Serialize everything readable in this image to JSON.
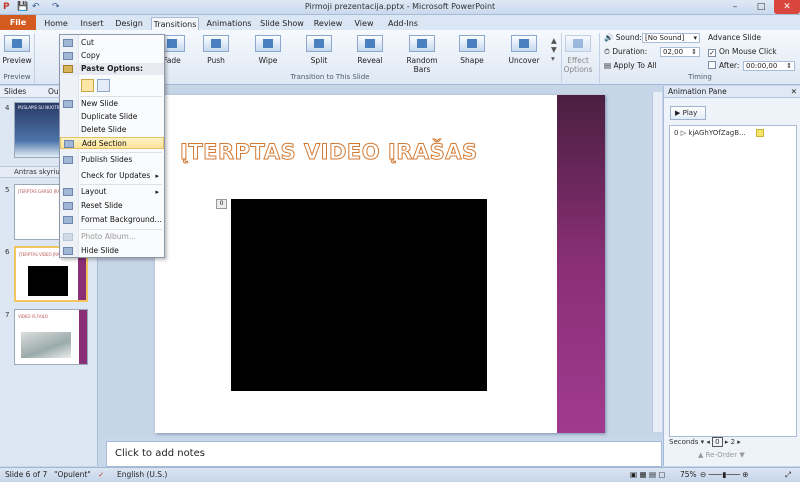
{
  "window": {
    "title": "Pirmoji prezentacija.pptx - Microsoft PowerPoint",
    "controls": [
      "–",
      "□",
      "✕"
    ]
  },
  "quick_access": {
    "app_icon": "P",
    "save": "💾",
    "undo": "↶",
    "redo": "↷"
  },
  "tabs": [
    "File",
    "Home",
    "Insert",
    "Design",
    "Transitions",
    "Animations",
    "Slide Show",
    "Review",
    "View",
    "Add-Ins"
  ],
  "active_tab": "Transitions",
  "ribbon": {
    "preview": {
      "label": "Preview",
      "group": "Preview"
    },
    "transitions": [
      "Fade",
      "Push",
      "Wipe",
      "Split",
      "Reveal",
      "Random Bars",
      "Shape",
      "Uncover"
    ],
    "transition_group": "Transition to This Slide",
    "effect_options": "Effect Options",
    "timing": {
      "sound_label": "Sound:",
      "sound_value": "[No Sound]",
      "duration_label": "Duration:",
      "duration_value": "02,00",
      "apply_all": "Apply To All",
      "advance_label": "Advance Slide",
      "on_mouse_click": "On Mouse Click",
      "after_label": "After:",
      "after_value": "00:00,00",
      "group": "Timing"
    }
  },
  "left_panel": {
    "tabs": [
      "Slides",
      "Out"
    ],
    "section_label": "Antras skyrius",
    "slides": [
      {
        "num": "4",
        "caption": "PUSLAPIS SU NUOTRAUKA"
      },
      {
        "num": "5",
        "caption": "ĮTERPTAS GARSO ĮRAŠAS"
      },
      {
        "num": "6",
        "caption": "ĮTERPTAS VIDEO ĮRAŠAS"
      },
      {
        "num": "7",
        "caption": "VIDEO IŠ FAILO"
      }
    ]
  },
  "slide": {
    "title": "ĮTERPTAS VIDEO ĮRAŠAS",
    "anim_tag": "0"
  },
  "notes": {
    "placeholder": "Click to add notes"
  },
  "animation_pane": {
    "title": "Animation Pane",
    "play": "Play",
    "item_number": "0",
    "item_label": "kjAGhYOfZagB...",
    "seconds_label": "Seconds",
    "page_from": "0",
    "page_to": "2",
    "reorder": "Re-Order"
  },
  "context_menu": {
    "items": [
      {
        "label": "Cut",
        "enabled": true
      },
      {
        "label": "Copy",
        "enabled": true
      },
      {
        "label": "Paste Options:",
        "header": true
      },
      {
        "label": "New Slide",
        "enabled": true
      },
      {
        "label": "Duplicate Slide",
        "enabled": true
      },
      {
        "label": "Delete Slide",
        "enabled": true
      },
      {
        "label": "Add Section",
        "enabled": true,
        "highlighted": true
      },
      {
        "label": "Publish Slides",
        "enabled": true
      },
      {
        "label": "Check for Updates",
        "enabled": true,
        "submenu": true
      },
      {
        "label": "Layout",
        "enabled": true,
        "submenu": true
      },
      {
        "label": "Reset Slide",
        "enabled": true
      },
      {
        "label": "Format Background...",
        "enabled": true
      },
      {
        "label": "Photo Album...",
        "enabled": false
      },
      {
        "label": "Hide Slide",
        "enabled": true
      }
    ]
  },
  "status_bar": {
    "slide_info": "Slide 6 of 7",
    "theme": "\"Opulent\"",
    "language": "English (U.S.)",
    "zoom": "75%"
  },
  "colors": {
    "file_tab": "#d45b1f",
    "slide_band": "#8a2f76",
    "title_outline": "#d27a34",
    "menu_highlight": "#fbe39a"
  }
}
